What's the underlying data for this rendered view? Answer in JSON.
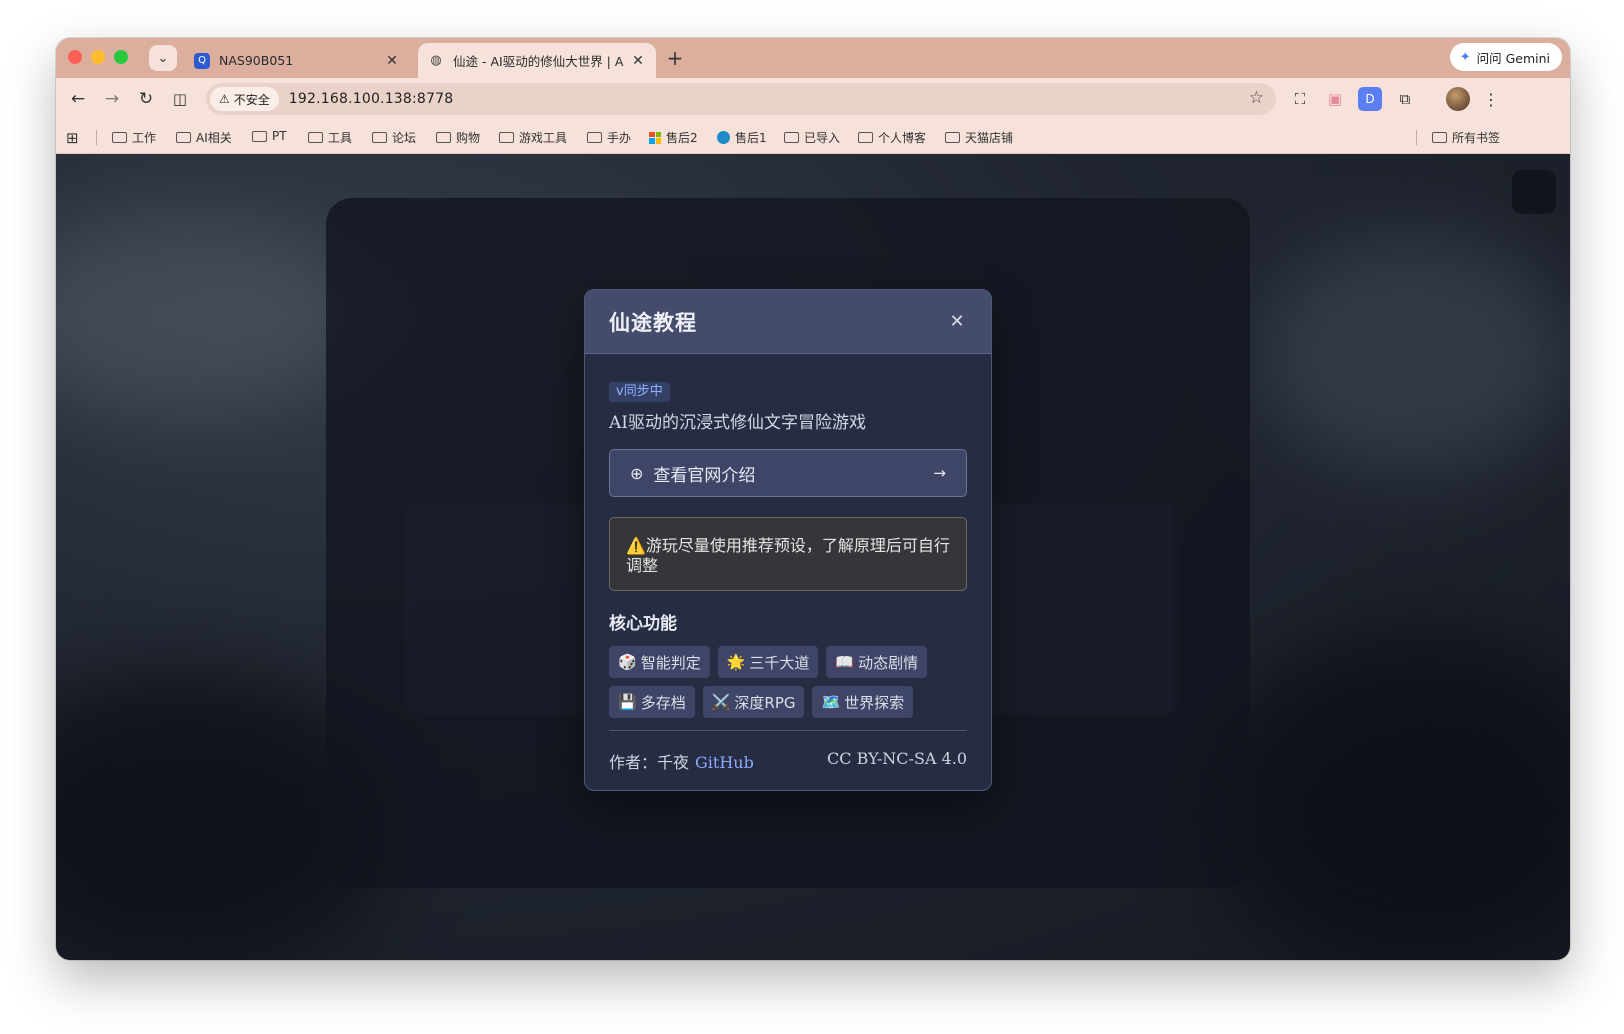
{
  "browser": {
    "tabs": [
      {
        "title": "NAS90B051",
        "favicon": "nas-icon"
      },
      {
        "title": "仙途 - AI驱动的修仙大世界 | AI",
        "favicon": "globe-icon"
      }
    ],
    "gemini_label": "问问 Gemini",
    "security_label": "不安全",
    "url": "192.168.100.138:8778",
    "bookmarks": [
      "工作",
      "AI相关",
      "PT",
      "工具",
      "论坛",
      "购物",
      "游戏工具",
      "手办",
      "售后2",
      "售后1",
      "已导入",
      "个人博客",
      "天猫店铺"
    ],
    "all_bookmarks": "所有书签"
  },
  "modal": {
    "title": "仙途教程",
    "sync_badge": "v同步中",
    "tagline": "AI驱动的沉浸式修仙文字冒险游戏",
    "site_link": "查看官网介绍",
    "warning_icon": "⚠️",
    "warning": "游玩尽量使用推荐预设，了解原理后可自行调整",
    "section_title": "核心功能",
    "features": [
      {
        "icon": "🎲",
        "label": "智能判定"
      },
      {
        "icon": "🌟",
        "label": "三千大道"
      },
      {
        "icon": "📖",
        "label": "动态剧情"
      },
      {
        "icon": "💾",
        "label": "多存档"
      },
      {
        "icon": "⚔️",
        "label": "深度RPG"
      },
      {
        "icon": "🗺️",
        "label": "世界探索"
      }
    ],
    "author_label": "作者：千夜",
    "github_label": "GitHub",
    "license": "CC BY-NC-SA 4.0"
  },
  "colors": {
    "tab_strip": "#dcae9e",
    "toolbar": "#f6e2da",
    "modal_bg": "#262c42",
    "modal_header": "#454b6b",
    "accent_link": "#8fa8ff"
  }
}
